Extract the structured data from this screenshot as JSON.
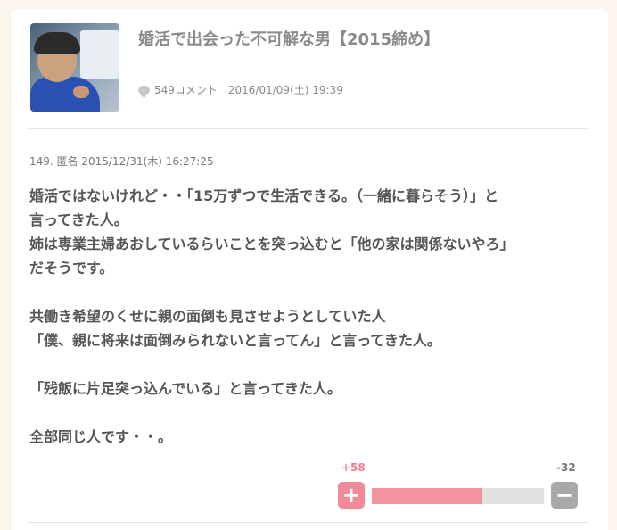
{
  "article": {
    "title": "婚活で出会った不可解な男【2015締め】",
    "comment_count": "549コメント",
    "date": "2016/01/09(土) 19:39"
  },
  "comment": {
    "header": "149. 匿名 2015/12/31(木) 16:27:25",
    "body": "婚活ではないけれど・・「15万ずつで生活できる。（一緒に暮らそう）」と\n言ってきた人。\n姉は専業主婦あおしているらいことを突っ込むと「他の家は関係ないやろ」\nだそうです。\n\n共働き希望のくせに親の面倒も見させようとしていた人\n「僕、親に将来は面倒みられないと言ってん」と言ってきた人。\n\n「残飯に片足突っ込んでいる」と言ってきた人。\n\n全部同じ人です・・。",
    "plus_count": "+58",
    "minus_count": "-32",
    "plus_symbol": "+",
    "minus_symbol": "−",
    "plus_ratio": 0.64
  },
  "colors": {
    "accent_pink": "#ef8a99",
    "neutral_gray": "#a9a9a9",
    "background": "#fbf5ee"
  }
}
